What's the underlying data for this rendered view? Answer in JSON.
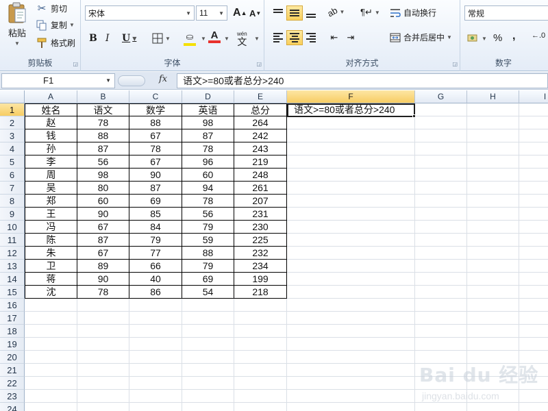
{
  "ribbon": {
    "clipboard": {
      "paste": "粘贴",
      "cut": "剪切",
      "copy": "复制",
      "format_painter": "格式刷",
      "group_label": "剪贴板"
    },
    "font": {
      "font_name": "宋体",
      "font_size": "11",
      "bold": "B",
      "italic": "I",
      "underline": "U",
      "grow_font": "A",
      "shrink_font": "A",
      "phonetic": "wén",
      "font_color_letter": "A",
      "group_label": "字体",
      "font_color_hex": "#e8312d",
      "fill_color_hex": "#f5e000"
    },
    "alignment": {
      "wrap_text": "自动换行",
      "merge_center": "合并后居中",
      "group_label": "对齐方式"
    },
    "number": {
      "format": "常规",
      "percent": "%",
      "comma": ",",
      "group_label": "数字"
    }
  },
  "formula_bar": {
    "name_box": "F1",
    "fx_label": "fx",
    "formula": "语文>=80或者总分>240"
  },
  "sheet": {
    "columns": [
      "A",
      "B",
      "C",
      "D",
      "E",
      "F",
      "G",
      "H",
      "I"
    ],
    "row_numbers": [
      "1",
      "2",
      "3",
      "4",
      "5",
      "6",
      "7",
      "8",
      "9",
      "10",
      "11",
      "12",
      "13",
      "14",
      "15",
      "16",
      "17",
      "18",
      "19",
      "20",
      "21",
      "22",
      "23",
      "24"
    ],
    "header_row": [
      "姓名",
      "语文",
      "数学",
      "英语",
      "总分",
      "语文>=80或者总分>240"
    ],
    "data_rows": [
      [
        "赵",
        "78",
        "88",
        "98",
        "264"
      ],
      [
        "钱",
        "88",
        "67",
        "87",
        "242"
      ],
      [
        "孙",
        "87",
        "78",
        "78",
        "243"
      ],
      [
        "李",
        "56",
        "67",
        "96",
        "219"
      ],
      [
        "周",
        "98",
        "90",
        "60",
        "248"
      ],
      [
        "吴",
        "80",
        "87",
        "94",
        "261"
      ],
      [
        "郑",
        "60",
        "69",
        "78",
        "207"
      ],
      [
        "王",
        "90",
        "85",
        "56",
        "231"
      ],
      [
        "冯",
        "67",
        "84",
        "79",
        "230"
      ],
      [
        "陈",
        "87",
        "79",
        "59",
        "225"
      ],
      [
        "朱",
        "67",
        "77",
        "88",
        "232"
      ],
      [
        "卫",
        "89",
        "66",
        "79",
        "234"
      ],
      [
        "蒋",
        "90",
        "40",
        "69",
        "199"
      ],
      [
        "沈",
        "78",
        "86",
        "54",
        "218"
      ]
    ],
    "selected_cell": "F1",
    "selection_color": "#f7cd63"
  },
  "watermark": {
    "main": "Bai du 经验",
    "sub": "jingyan.baidu.com"
  }
}
